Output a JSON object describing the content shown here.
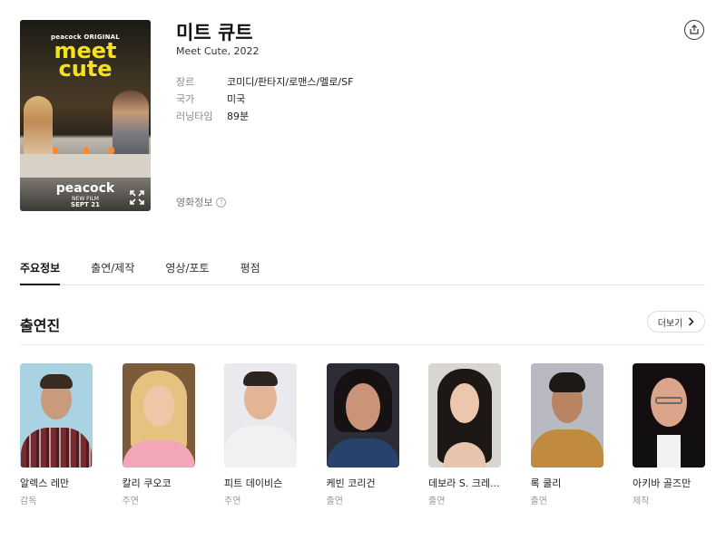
{
  "movie": {
    "title": "미트 큐트",
    "subtitle": "Meet Cute, 2022",
    "meta": [
      {
        "key": "장르",
        "value": "코미디/판타지/로맨스/멜로/SF"
      },
      {
        "key": "국가",
        "value": "미국"
      },
      {
        "key": "러닝타임",
        "value": "89분"
      }
    ],
    "info_link": "영화정보",
    "info_icon_glyph": "!",
    "poster": {
      "top_brand": "peacock ORIGINAL",
      "title_line1": "meet",
      "title_line2": "cute",
      "brand": "peacock",
      "new_film": "NEW FILM",
      "date": "SEPT 21"
    }
  },
  "tabs": [
    {
      "label": "주요정보",
      "active": true
    },
    {
      "label": "출연/제작",
      "active": false
    },
    {
      "label": "영상/포토",
      "active": false
    },
    {
      "label": "평점",
      "active": false
    }
  ],
  "cast_section": {
    "title": "출연진",
    "more_label": "더보기"
  },
  "cast": [
    {
      "name": "알렉스 레만",
      "role": "감독"
    },
    {
      "name": "칼리 쿠오코",
      "role": "주연"
    },
    {
      "name": "피트 데이비슨",
      "role": "주연"
    },
    {
      "name": "케빈 코리건",
      "role": "출연"
    },
    {
      "name": "데보라 S. 크레...",
      "role": "출연"
    },
    {
      "name": "록 쿨리",
      "role": "출연"
    },
    {
      "name": "아키바 골즈만",
      "role": "제작"
    }
  ],
  "icons": {
    "share": "share-icon",
    "expand": "expand-icon",
    "chevron": "chevron-right-icon",
    "info": "info-icon"
  }
}
